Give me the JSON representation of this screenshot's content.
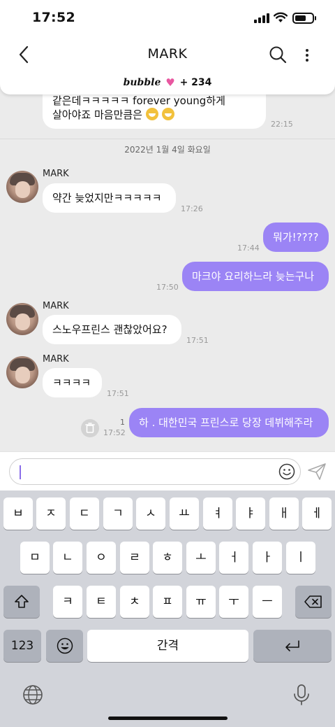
{
  "status_bar": {
    "time": "17:52"
  },
  "header": {
    "title": "MARK"
  },
  "banner": {
    "brand": "bubble",
    "suffix": "+ 234"
  },
  "messages": {
    "m0": {
      "text1": "같은데ㅋㅋㅋㅋㅋ forever young하게",
      "text2": "살아야죠 마음만큼은",
      "time": "22:15"
    },
    "date_separator": "2022년 1월 4일 화요일",
    "m1": {
      "sender": "MARK",
      "text": "약간 늦었지만ㅋㅋㅋㅋㅋ",
      "time": "17:26"
    },
    "m2": {
      "text": "뭐가!????",
      "time": "17:44"
    },
    "m3": {
      "text": "마크야 요리하느라 늦는구나",
      "time": "17:50"
    },
    "m4": {
      "sender": "MARK",
      "text": "스노우프린스 괜찮았어요?",
      "time": "17:51"
    },
    "m5": {
      "sender": "MARK",
      "text": "ㅋㅋㅋㅋ",
      "time": "17:51"
    },
    "m6": {
      "text": "하 . 대한민국 프린스로 당장 데뷔해주라",
      "time": "17:52",
      "unread": "1"
    }
  },
  "input": {
    "value": ""
  },
  "keyboard": {
    "row1": [
      "ㅂ",
      "ㅈ",
      "ㄷ",
      "ㄱ",
      "ㅅ",
      "ㅛ",
      "ㅕ",
      "ㅑ",
      "ㅐ",
      "ㅔ"
    ],
    "row2": [
      "ㅁ",
      "ㄴ",
      "ㅇ",
      "ㄹ",
      "ㅎ",
      "ㅗ",
      "ㅓ",
      "ㅏ",
      "ㅣ"
    ],
    "row3": [
      "ㅋ",
      "ㅌ",
      "ㅊ",
      "ㅍ",
      "ㅠ",
      "ㅜ",
      "ㅡ"
    ],
    "numbers": "123",
    "space": "간격"
  },
  "colors": {
    "outgoing_bubble": "#9b84f5",
    "chat_background": "#ebebeb",
    "heart": "#e857a0"
  }
}
